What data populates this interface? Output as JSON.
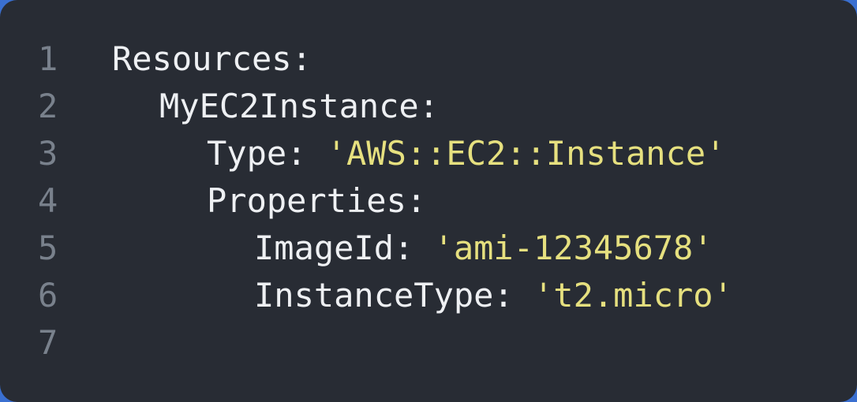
{
  "editor": {
    "lines": [
      {
        "number": "1",
        "key": "Resources:",
        "value": ""
      },
      {
        "number": "2",
        "key": "MyEC2Instance:",
        "value": ""
      },
      {
        "number": "3",
        "key": "Type: ",
        "value": "'AWS::EC2::Instance'"
      },
      {
        "number": "4",
        "key": "Properties:",
        "value": ""
      },
      {
        "number": "5",
        "key": "ImageId: ",
        "value": "'ami-12345678'"
      },
      {
        "number": "6",
        "key": "InstanceType: ",
        "value": "'t2.micro'"
      },
      {
        "number": "7",
        "key": "",
        "value": ""
      }
    ]
  },
  "colors": {
    "background": "#282c34",
    "line_number": "#79818c",
    "key": "#eef0f3",
    "string": "#e6e07f"
  }
}
